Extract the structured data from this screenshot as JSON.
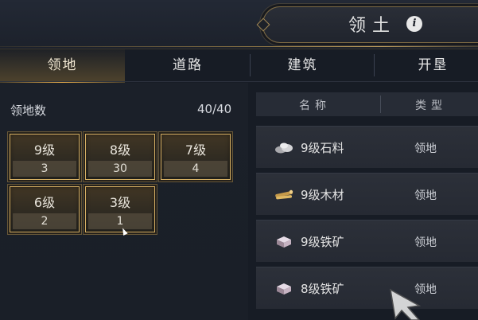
{
  "header": {
    "title": "领土",
    "info_icon": "i"
  },
  "tabs": [
    {
      "label": "领地",
      "active": true
    },
    {
      "label": "道路",
      "active": false
    },
    {
      "label": "建筑",
      "active": false
    },
    {
      "label": "开垦",
      "active": false
    }
  ],
  "territory": {
    "count_label": "领地数",
    "count_value": "40/40",
    "levels": [
      {
        "level": "9级",
        "count": "3"
      },
      {
        "level": "8级",
        "count": "30"
      },
      {
        "level": "7级",
        "count": "4"
      },
      {
        "level": "6级",
        "count": "2"
      },
      {
        "level": "3级",
        "count": "1"
      }
    ]
  },
  "list": {
    "columns": {
      "name": "名称",
      "type": "类型"
    },
    "rows": [
      {
        "name": "9级石料",
        "type": "领地",
        "icon": "stone-icon"
      },
      {
        "name": "9级木材",
        "type": "领地",
        "icon": "wood-icon"
      },
      {
        "name": "9级铁矿",
        "type": "领地",
        "icon": "iron-ore-icon"
      },
      {
        "name": "8级铁矿",
        "type": "领地",
        "icon": "iron-ore-icon"
      }
    ]
  },
  "colors": {
    "accent_gold": "#d4ae63",
    "background": "#171c25",
    "row_bg": "#2a2e37"
  }
}
